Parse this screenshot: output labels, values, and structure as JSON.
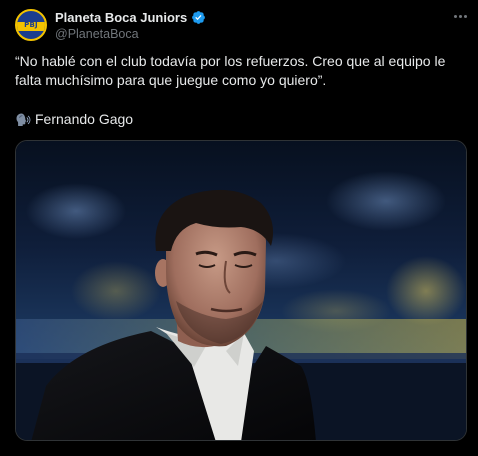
{
  "tweet": {
    "author": {
      "display_name": "Planeta Boca Juniors",
      "handle": "@PlanetaBoca",
      "avatar_text": "PBJ",
      "verified": true
    },
    "text": "“No hablé con el club todavía por los refuerzos. Creo que al equipo le falta muchísimo para que juegue como yo quiero”.",
    "attribution": "Fernando Gago",
    "attribution_icon": "speaking-head-icon",
    "more_icon": "more-options-icon",
    "media": {
      "type": "photo"
    }
  },
  "colors": {
    "background": "#000000",
    "text_primary": "#e7e9ea",
    "text_secondary": "#71767b",
    "verified_blue": "#1d9bf0",
    "boca_blue": "#1b3d8f",
    "boca_gold": "#f2c200"
  }
}
